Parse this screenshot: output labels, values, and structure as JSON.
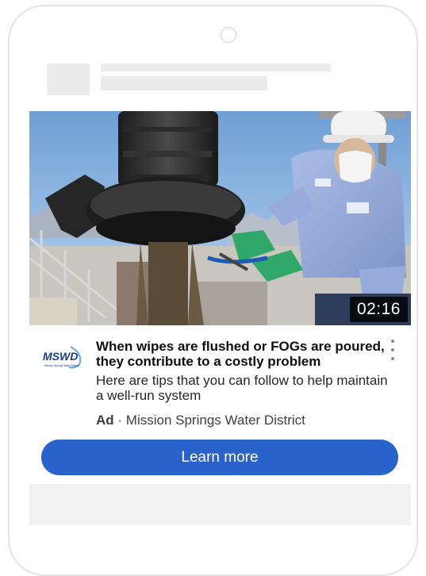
{
  "video": {
    "duration": "02:16"
  },
  "advertiser": {
    "logo_text": "MSWD",
    "logo_subtext": "Mission Springs Water District",
    "logo_color": "#1a3e8c"
  },
  "ad": {
    "headline": "When wipes are flushed or FOGs are poured, they contribute to a costly problem",
    "description": "Here are tips that you can follow to help maintain a well-run system",
    "ad_badge": "Ad",
    "separator": " · ",
    "advertiser_name": "Mission Springs Water District",
    "cta_label": "Learn more",
    "cta_color": "#2a62cb"
  },
  "icons": {
    "menu": "more-vert-icon",
    "camera": "camera-icon"
  }
}
